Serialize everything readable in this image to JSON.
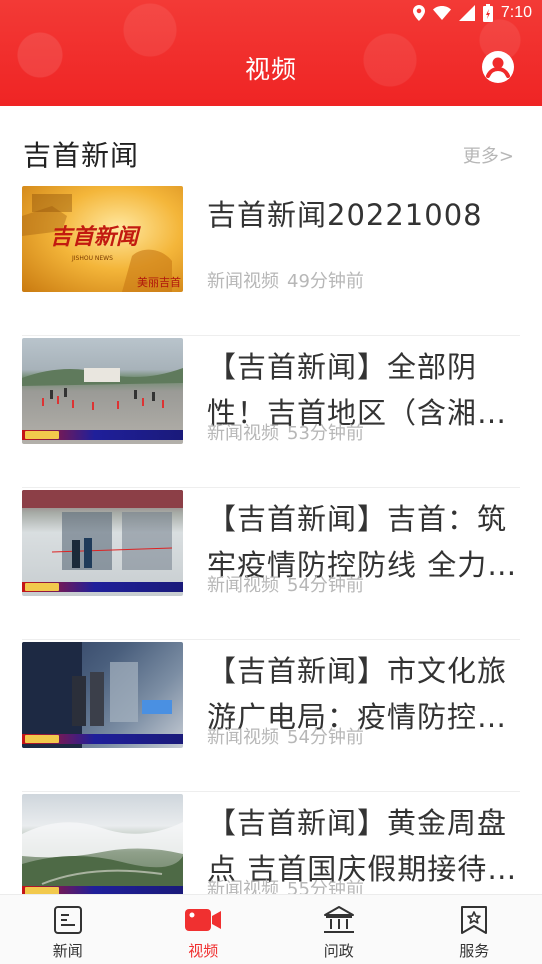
{
  "status": {
    "time": "7:10"
  },
  "header": {
    "title": "视频"
  },
  "section": {
    "title": "吉首新闻",
    "more": "更多>"
  },
  "items": [
    {
      "title": "吉首新闻20221008",
      "source": "新闻视频",
      "time": "49分钟前"
    },
    {
      "title": "【吉首新闻】全部阴性！吉首地区（含湘…",
      "source": "新闻视频",
      "time": "53分钟前"
    },
    {
      "title": "【吉首新闻】吉首：筑牢疫情防控防线 全力…",
      "source": "新闻视频",
      "time": "54分钟前"
    },
    {
      "title": "【吉首新闻】市文化旅游广电局：疫情防控…",
      "source": "新闻视频",
      "time": "54分钟前"
    },
    {
      "title": "【吉首新闻】黄金周盘点 吉首国庆假期接待…",
      "source": "新闻视频",
      "time": "55分钟前"
    }
  ],
  "tabs": [
    {
      "label": "新闻",
      "icon": "news-icon",
      "active": false
    },
    {
      "label": "视频",
      "icon": "video-icon",
      "active": true
    },
    {
      "label": "问政",
      "icon": "government-icon",
      "active": false
    },
    {
      "label": "服务",
      "icon": "service-icon",
      "active": false
    }
  ],
  "colors": {
    "brand": "#f02a2a",
    "meta": "#b7b7b7",
    "active_tab": "#f03030"
  }
}
